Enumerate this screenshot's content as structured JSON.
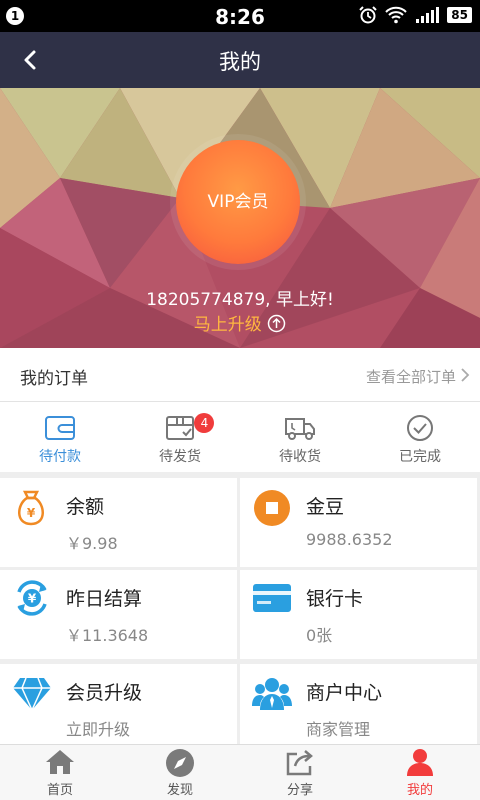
{
  "status_bar": {
    "notification_count": "1",
    "time": "8:26",
    "battery": "85"
  },
  "header": {
    "title": "我的"
  },
  "hero": {
    "vip_label": "VIP会员",
    "greeting": "18205774879, 早上好!",
    "upgrade_label": "马上升级"
  },
  "orders": {
    "title": "我的订单",
    "view_all": "查看全部订单",
    "tabs": [
      {
        "label": "待付款",
        "icon": "wallet-icon"
      },
      {
        "label": "待发货",
        "icon": "package-icon",
        "badge": "4"
      },
      {
        "label": "待收货",
        "icon": "truck-icon"
      },
      {
        "label": "已完成",
        "icon": "check-circle-icon"
      }
    ]
  },
  "assets": [
    {
      "title": "余额",
      "value": "￥9.98",
      "icon": "money-bag-icon"
    },
    {
      "title": "金豆",
      "value": "9988.6352",
      "icon": "gold-bean-icon"
    },
    {
      "title": "昨日结算",
      "value": "￥11.3648",
      "icon": "settlement-icon"
    },
    {
      "title": "银行卡",
      "value": "0张",
      "icon": "bank-card-icon"
    },
    {
      "title": "会员升级",
      "value": "立即升级",
      "icon": "diamond-icon"
    },
    {
      "title": "商户中心",
      "value": "商家管理",
      "icon": "merchant-icon"
    }
  ],
  "tabbar": [
    {
      "label": "首页",
      "icon": "home-icon"
    },
    {
      "label": "发现",
      "icon": "compass-icon"
    },
    {
      "label": "分享",
      "icon": "share-icon"
    },
    {
      "label": "我的",
      "icon": "person-icon"
    }
  ],
  "colors": {
    "accent": "#3b8fd9",
    "active_tab": "#f23c3c",
    "title_bar": "#2f3147",
    "upgrade": "#ffb640"
  }
}
